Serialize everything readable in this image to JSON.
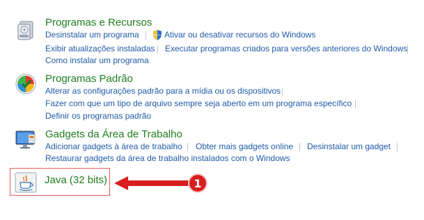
{
  "categories": [
    {
      "title": "Programas e Recursos",
      "icon": "programs-features-icon",
      "links": [
        "Desinstalar um programa",
        "Ativar ou desativar recursos do Windows",
        "Exibir atualizações instaladas",
        "Executar programas criados para versões anteriores do Windows",
        "Como instalar um programa"
      ]
    },
    {
      "title": "Programas Padrão",
      "icon": "default-programs-icon",
      "links": [
        "Alterar as configurações padrão para a mídia ou os dispositivos",
        "Fazer com que um tipo de arquivo sempre seja aberto em um programa específico",
        "Definir os programas padrão"
      ]
    },
    {
      "title": "Gadgets da Área de Trabalho",
      "icon": "desktop-gadgets-icon",
      "links": [
        "Adicionar gadgets à área de trabalho",
        "Obter mais gadgets online",
        "Desinstalar um gadget",
        "Restaurar gadgets da área de trabalho instalados com o Windows"
      ]
    }
  ],
  "java": {
    "title": "Java (32 bits)",
    "icon": "java-icon"
  },
  "annotation": {
    "badge_number": "1",
    "color": "#d81f1f"
  },
  "colors": {
    "title_green": "#1e7d1e",
    "link_blue": "#1f5aa8",
    "separator": "#b9c6d8"
  }
}
